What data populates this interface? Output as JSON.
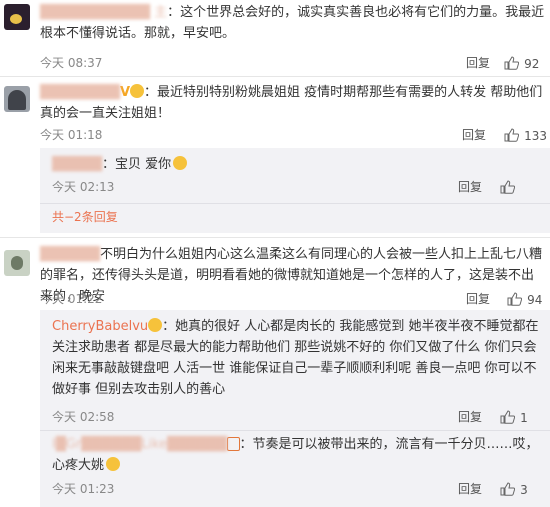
{
  "comments": [
    {
      "name_obscured": "███████████ 主",
      "text": "：这个世界总会好的，诚实真实善良也必将有它们的力量。我最近根本不懂得说话。那就，早安吧。",
      "time": "今天 08:37",
      "reply_label": "回复",
      "likes": "92"
    },
    {
      "name_obscured": "████████",
      "text": "：最近特别特别粉姚晨姐姐 疫情时期帮那些有需要的人转发 帮助他们 真的会一直关注姐姐！",
      "time": "今天 01:18",
      "reply_label": "回复",
      "likes": "133",
      "sub_replies": [
        {
          "name_obscured": "█████",
          "text": "：宝贝 爱你",
          "time": "今天 02:13",
          "reply_label": "回复"
        }
      ],
      "more_replies": "共−2条回复"
    },
    {
      "name_obscured": "██████",
      "text": "不明白为什么姐姐内心这么温柔这么有同理心的人会被一些人扣上上乱七八糟的罪名，还传得头头是道，明明看看她的微博就知道她是一个怎样的人了，这是装不出来的，晚安",
      "time": "今天 01:22",
      "reply_label": "回复",
      "likes": "94",
      "sub_replies": [
        {
          "name": "CherryBabelvu",
          "text": "：她真的很好 人心都是肉长的 我能感觉到 她半夜半夜不睡觉都在关注求助患者 都是尽最大的能力帮助他们 那些说姚不好的 你们又做了什么 你们只会闲来无事敲敲键盘吧 人活一世 谁能保证自己一辈子顺顺利利呢 善良一点吧 你可以不做好事 但别去攻击别人的善心",
          "time": "今天 02:58",
          "reply_label": "回复",
          "likes": "1"
        },
        {
          "name_obscured": "I█Gr██████Like██████",
          "text": "：节奏是可以被带出来的，流言有一千分贝……哎，心疼大姚",
          "time": "今天 01:23",
          "reply_label": "回复",
          "likes": "3"
        }
      ]
    }
  ],
  "icons": {
    "like": "thumbs-up-icon",
    "vip": "v-badge-icon",
    "emoji": "emoji-icon"
  },
  "colors": {
    "username": "#eb7350",
    "more_link": "#eb7350",
    "reply_bg": "#f2f2f5"
  }
}
